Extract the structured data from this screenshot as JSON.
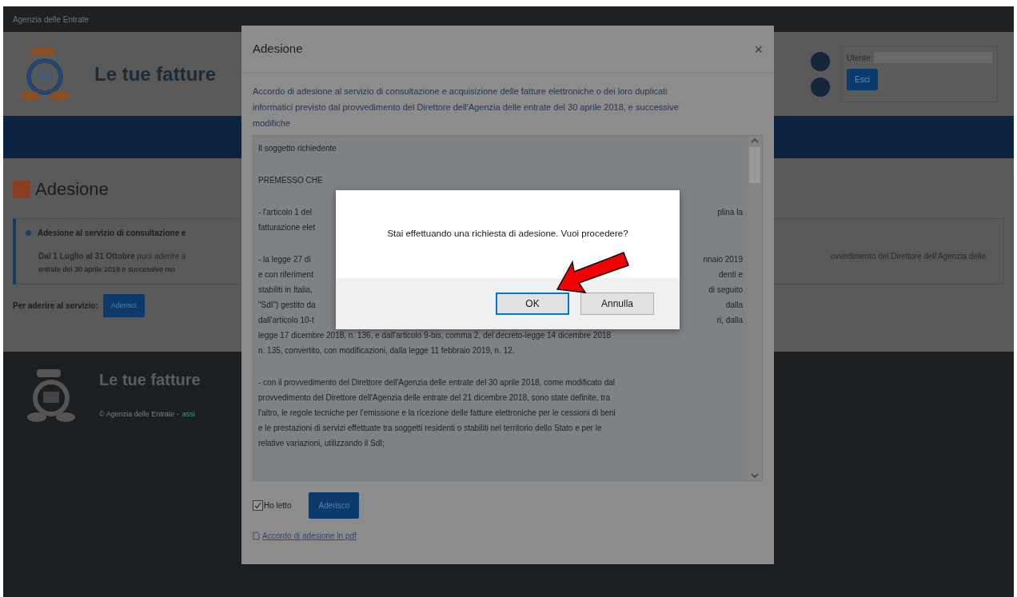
{
  "top_bar": {
    "title": "Agenzia delle Entrate"
  },
  "header": {
    "title": "Le tue fatture",
    "user_label": "Utente:",
    "logout_button": "Esci"
  },
  "page": {
    "title": "Adesione",
    "info": {
      "heading": "Adesione al servizio di consultazione e",
      "line_1": "**Dal 1 Luglio al 31 Ottobre** puoi aderire a",
      "line_2": "entrate del 30 aprile 2018 e successive mo",
      "right_fragment": "ovvedimento del Direttore dell'Agenzia delle"
    },
    "join_label": "Per aderire al servizio:",
    "join_button": "Aderisci"
  },
  "footer": {
    "title": "Le tue fatture",
    "copyright": "© Agenzia delle Entrate -",
    "link": "assi"
  },
  "modal": {
    "title": "Adesione",
    "close": "×",
    "intro": "Accordo di adesione al servizio di consultazione e acquisizione delle fatture elettroniche o dei loro duplicati informatici previsto dal provvedimento del Direttore dell'Agenzia delle entrate del 30 aprile 2018, e successive modifiche",
    "paragraphs": [
      {
        "lines": [
          {
            "left": "Il soggetto richiedente"
          }
        ]
      },
      {
        "lines": [
          {
            "left": "PREMESSO CHE"
          }
        ]
      },
      {
        "lines": [
          {
            "left": "- l'articolo 1 del",
            "right": "plina la"
          },
          {
            "left": "fatturazione elet"
          }
        ]
      },
      {
        "lines": [
          {
            "left": "- la legge 27 di",
            "right": "nnaio 2019"
          },
          {
            "left": "e con riferiment",
            "right": "denti e"
          },
          {
            "left": "stabiliti in Italia,",
            "right": "di seguito"
          },
          {
            "left": "\"SdI\") gestito da",
            "right": "dalla"
          },
          {
            "left": "dall'articolo 10-t",
            "right": "ri, dalla"
          },
          {
            "left": "legge 17 dicembre 2018, n. 136, e dall'articolo 9-bis, comma 2, del decreto-legge 14 dicembre 2018"
          },
          {
            "left": "n. 135, convertito, con modificazioni, dalla legge 11 febbraio 2019, n. 12."
          }
        ]
      },
      {
        "lines": [
          {
            "left": "- con il provvedimento del Direttore dell'Agenzia delle entrate del 30 aprile 2018, come modificato dal"
          },
          {
            "left": "provvedimento del Direttore dell'Agenzia delle entrate del 21 dicembre 2018, sono state definite, tra"
          },
          {
            "left": "l'altro, le regole tecniche per l'emissione e la ricezione delle fatture elettroniche per le cessioni di beni"
          },
          {
            "left": "e le prestazioni di servizi effettuate tra soggetti residenti o stabiliti nel territorio dello Stato e per le"
          },
          {
            "left": "relative variazioni, utilizzando il SdI;"
          }
        ]
      }
    ],
    "checkbox": {
      "label": "Ho letto",
      "checked": true
    },
    "submit_button": "Aderisco",
    "pdf_link": "Accordo di adesione in pdf"
  },
  "confirm": {
    "message": "Stai effettuando una richiesta di adesione. Vuoi procedere?",
    "buttons": [
      {
        "label": "OK",
        "selected": true
      },
      {
        "label": "Annulla",
        "selected": false
      }
    ]
  }
}
